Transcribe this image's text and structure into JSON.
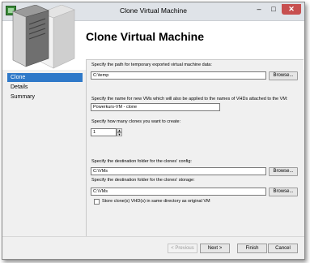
{
  "window": {
    "title": "Clone Virtual Machine",
    "min_symbol": "–",
    "max_symbol": "□",
    "close_symbol": "✕"
  },
  "header": {
    "heading": "Clone Virtual Machine"
  },
  "sidebar": {
    "items": [
      {
        "label": "Clone",
        "active": true
      },
      {
        "label": "Details",
        "active": false
      },
      {
        "label": "Summary",
        "active": false
      }
    ]
  },
  "form": {
    "temp_path_label": "Specify the path for temporary exported virtual machine data:",
    "temp_path_value": "C:\\temp",
    "vm_name_label": "Specify the name for new VMs which will also be applied to the names of VHDs attached to the VM:",
    "vm_name_value": "Powerkurs-VM - clone",
    "clones_label": "Specify how many clones you want to create:",
    "clones_value": "1",
    "config_label": "Specify the destination folder for the clones' config:",
    "config_value": "C:\\VMs",
    "storage_label": "Specify the destination folder for the clones' storage:",
    "storage_value": "C:\\VMs",
    "store_checkbox_label": "Store clone(s) VHD(s) in same directory as original VM",
    "store_checkbox_checked": false,
    "browse_label": "Browse...",
    "spin_up": "▲",
    "spin_down": "▼"
  },
  "footer": {
    "previous_label": "< Previous",
    "next_label": "Next >",
    "finish_label": "Finish",
    "cancel_label": "Cancel"
  },
  "colors": {
    "accent": "#2f79c9",
    "close_button": "#c74f4f",
    "window_bg": "#f0f0f0"
  },
  "icons": [
    "app-icon",
    "server-graphic",
    "minimize-icon",
    "maximize-icon",
    "close-icon"
  ]
}
